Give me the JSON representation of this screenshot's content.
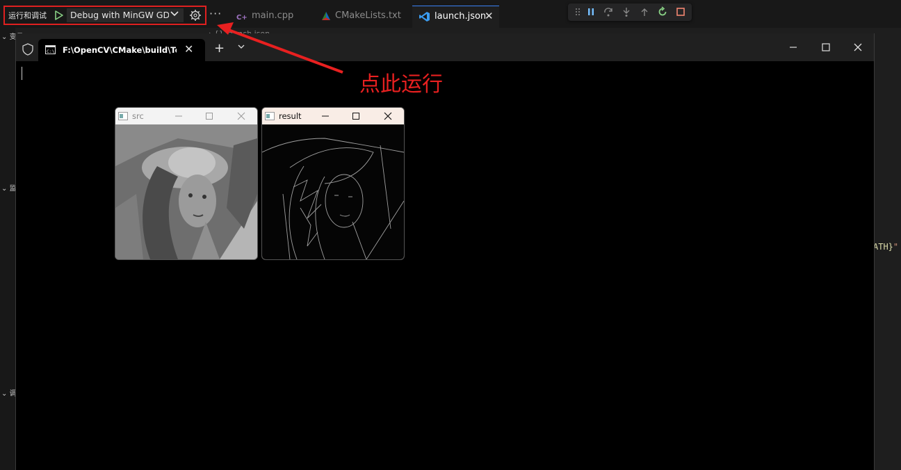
{
  "vscode": {
    "run_label": "运行和调试",
    "run_config": "Debug with MinGW GDB",
    "more": "···",
    "tabs": [
      {
        "label": "main.cpp",
        "icon": "cpp-icon"
      },
      {
        "label": "CMakeLists.txt",
        "icon": "cmake-icon"
      },
      {
        "label": "launch.json",
        "icon": "vscode-icon",
        "active": true
      }
    ],
    "sidebar_sections": [
      "变量",
      "监",
      "调"
    ],
    "breadcrumb": "› {} launch.json",
    "right_code": "ATH}",
    "right_code_quote": "\"",
    "debug_toolbar": [
      "drag-handle-icon",
      "pause-icon",
      "step-over-icon",
      "step-into-icon",
      "step-out-icon",
      "restart-icon",
      "stop-icon"
    ]
  },
  "terminal": {
    "tab_title": "F:\\OpenCV\\CMake\\build\\Test.exe",
    "new_tab": "+",
    "close": "✕"
  },
  "cv_windows": [
    {
      "title": "src"
    },
    {
      "title": "result"
    }
  ],
  "annotation": {
    "text": "点此运行",
    "color": "#e82020"
  },
  "colors": {
    "accent": "#3b82f6",
    "annotation": "#e82020",
    "play": "#89d185"
  }
}
